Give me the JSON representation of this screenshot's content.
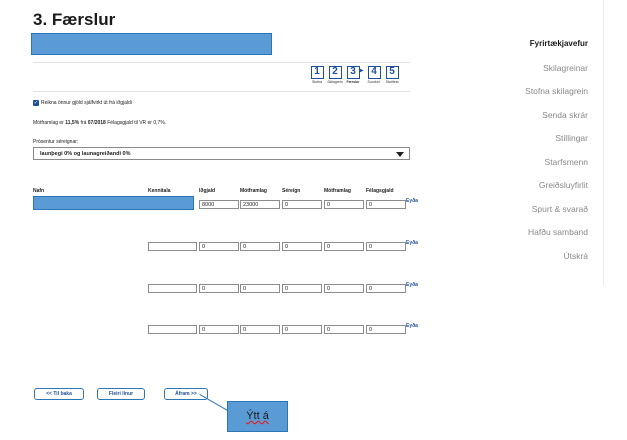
{
  "page": {
    "title": "3. Færslur"
  },
  "steps": [
    {
      "num": "1",
      "label": "Stofna"
    },
    {
      "num": "2",
      "label": "Skilagrein"
    },
    {
      "num": "3",
      "label": "Færslur"
    },
    {
      "num": "4",
      "label": "Sundurl."
    },
    {
      "num": "5",
      "label": "Staðfest"
    }
  ],
  "options": {
    "checkbox_label": "Reikna önnur gjöld sjálfvirkt út frá iðgjaldi",
    "checkbox_checked": true,
    "info_prefix": "Mótframlag er ",
    "info_rate1": "11,5%",
    "info_mid": " frá ",
    "info_date": "07/2018",
    "info_suffix": " Félagsgjald til VR er 0,7%.",
    "percent_label": "Prósentur séreignar:",
    "percent_selected": "launþegi 0% og launagreiðandi 0%"
  },
  "table": {
    "headers": [
      "Nafn",
      "Kennitala",
      "Iðgjald",
      "Mótframlag",
      "Séreign",
      "Mótframlag",
      "Félagsgjald"
    ],
    "rows": [
      {
        "name": "",
        "kennitala": "",
        "idgjald": "8000",
        "motframlag": "23000",
        "sereign": "0",
        "motframlag2": "0",
        "felagsgjald": "0",
        "delete": "Eyða"
      },
      {
        "name": "",
        "kennitala": "",
        "idgjald": "0",
        "motframlag": "0",
        "sereign": "0",
        "motframlag2": "0",
        "felagsgjald": "0",
        "delete": "Eyða"
      },
      {
        "name": "",
        "kennitala": "",
        "idgjald": "0",
        "motframlag": "0",
        "sereign": "0",
        "motframlag2": "0",
        "felagsgjald": "0",
        "delete": "Eyða"
      },
      {
        "name": "",
        "kennitala": "",
        "idgjald": "0",
        "motframlag": "0",
        "sereign": "0",
        "motframlag2": "0",
        "felagsgjald": "0",
        "delete": "Eyða"
      }
    ]
  },
  "buttons": {
    "back": "<< Til baka",
    "more_lines": "Fleiri línur",
    "next": "Áfram >>"
  },
  "callout": {
    "text": "Ýtt á"
  },
  "sidebar": {
    "items": [
      {
        "label": "Fyrirtækjavefur",
        "active": true
      },
      {
        "label": "Skilagreinar"
      },
      {
        "label": "Stofna skilagrein"
      },
      {
        "label": "Senda skrár"
      },
      {
        "label": "Stillingar"
      },
      {
        "label": "Starfsmenn"
      },
      {
        "label": "Greiðsluyfirlit"
      },
      {
        "label": "Spurt & svarað"
      },
      {
        "label": "Hafðu samband"
      },
      {
        "label": "Útskrá"
      }
    ]
  },
  "colors": {
    "accent": "#1f4e9c",
    "redaction": "#5b9bd5"
  }
}
